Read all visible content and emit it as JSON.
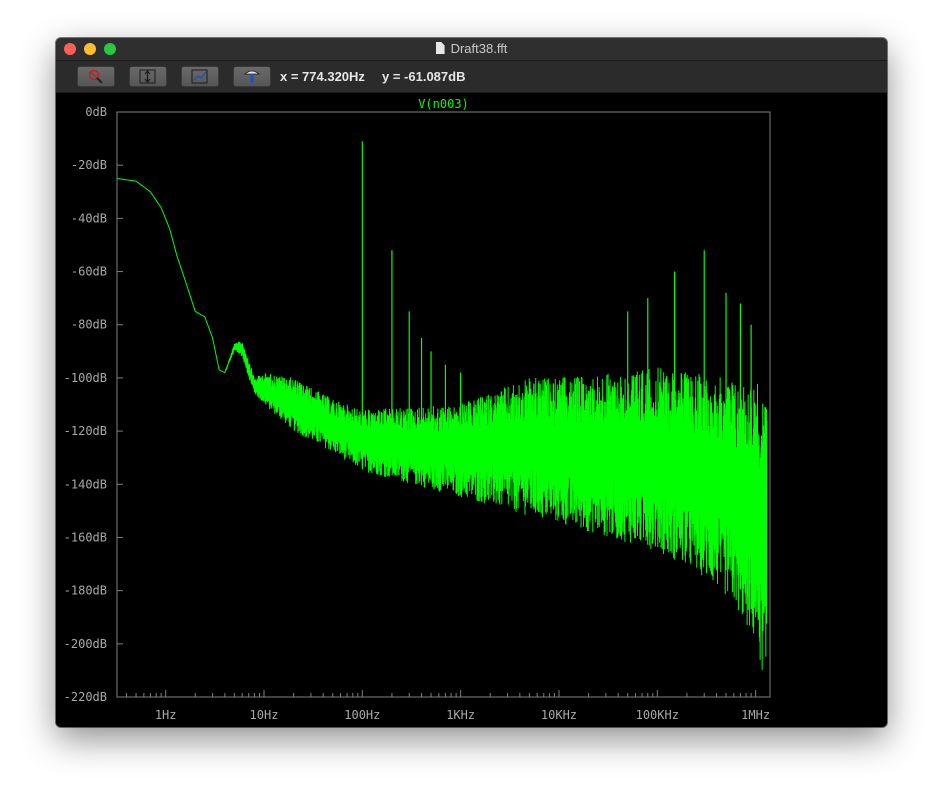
{
  "window": {
    "title": "Draft38.fft"
  },
  "toolbar": {
    "buttons": [
      {
        "name": "zoom-full-extent-button",
        "icon": "magnifier-icon"
      },
      {
        "name": "autorange-y-button",
        "icon": "autorange-icon"
      },
      {
        "name": "pan-button",
        "icon": "pan-icon"
      },
      {
        "name": "add-trace-button",
        "icon": "probe-icon"
      }
    ],
    "cursor_x": "x = 774.320Hz",
    "cursor_y": "y = -61.087dB"
  },
  "colors": {
    "background": "#000000",
    "trace": "#00ff00",
    "axis": "#808080",
    "labels": "#a8a8a8"
  },
  "chart_data": {
    "type": "line",
    "title": "V(n003)",
    "xlabel": "",
    "ylabel": "",
    "xscale": "log",
    "xlim": [
      0.32,
      1400000
    ],
    "ylim": [
      -220,
      0
    ],
    "grid": false,
    "y_ticks": [
      0,
      -20,
      -40,
      -60,
      -80,
      -100,
      -120,
      -140,
      -160,
      -180,
      -200,
      -220
    ],
    "y_tick_labels": [
      "0dB",
      "-20dB",
      "-40dB",
      "-60dB",
      "-80dB",
      "-100dB",
      "-120dB",
      "-140dB",
      "-160dB",
      "-180dB",
      "-200dB",
      "-220dB"
    ],
    "x_ticks": [
      1,
      10,
      100,
      1000,
      10000,
      100000,
      1000000
    ],
    "x_tick_labels": [
      "1Hz",
      "10Hz",
      "100Hz",
      "1KHz",
      "10KHz",
      "100KHz",
      "1MHz"
    ],
    "series": [
      {
        "name": "V(n003)",
        "envelope_top": [
          [
            0.32,
            -25
          ],
          [
            0.5,
            -26
          ],
          [
            0.7,
            -30
          ],
          [
            0.9,
            -36
          ],
          [
            1.1,
            -44
          ],
          [
            1.3,
            -54
          ],
          [
            1.6,
            -64
          ],
          [
            2.0,
            -75
          ],
          [
            2.5,
            -77
          ],
          [
            3.0,
            -85
          ],
          [
            3.5,
            -97
          ],
          [
            4.0,
            -98
          ],
          [
            5.0,
            -87
          ],
          [
            6.0,
            -86
          ],
          [
            7.0,
            -93
          ],
          [
            8.0,
            -100
          ],
          [
            10,
            -98
          ],
          [
            20,
            -100
          ],
          [
            50,
            -108
          ],
          [
            100,
            -112
          ],
          [
            1000,
            -110
          ],
          [
            5000,
            -100
          ],
          [
            10000,
            -100
          ],
          [
            100000,
            -96
          ],
          [
            500000,
            -100
          ],
          [
            1000000,
            -100
          ],
          [
            1300000,
            -110
          ]
        ],
        "envelope_bottom": [
          [
            0.32,
            -25
          ],
          [
            0.5,
            -26
          ],
          [
            0.7,
            -30
          ],
          [
            0.9,
            -36
          ],
          [
            1.1,
            -44
          ],
          [
            1.3,
            -54
          ],
          [
            1.6,
            -64
          ],
          [
            2.0,
            -75
          ],
          [
            2.5,
            -77
          ],
          [
            3.0,
            -85
          ],
          [
            3.5,
            -97
          ],
          [
            4.0,
            -98
          ],
          [
            5.0,
            -90
          ],
          [
            6.0,
            -92
          ],
          [
            7.0,
            -100
          ],
          [
            8.0,
            -106
          ],
          [
            10,
            -110
          ],
          [
            20,
            -120
          ],
          [
            50,
            -128
          ],
          [
            100,
            -135
          ],
          [
            1000,
            -145
          ],
          [
            10000,
            -155
          ],
          [
            100000,
            -165
          ],
          [
            300000,
            -175
          ],
          [
            600000,
            -185
          ],
          [
            1000000,
            -200
          ],
          [
            1300000,
            -218
          ]
        ],
        "spikes": [
          {
            "x": 100,
            "y": -11
          },
          {
            "x": 200,
            "y": -52
          },
          {
            "x": 300,
            "y": -75
          },
          {
            "x": 400,
            "y": -85
          },
          {
            "x": 500,
            "y": -90
          },
          {
            "x": 700,
            "y": -95
          },
          {
            "x": 1000,
            "y": -98
          },
          {
            "x": 50000,
            "y": -75
          },
          {
            "x": 80000,
            "y": -70
          },
          {
            "x": 150000,
            "y": -60
          },
          {
            "x": 300000,
            "y": -52
          },
          {
            "x": 500000,
            "y": -68
          },
          {
            "x": 700000,
            "y": -72
          },
          {
            "x": 900000,
            "y": -80
          }
        ]
      }
    ]
  }
}
